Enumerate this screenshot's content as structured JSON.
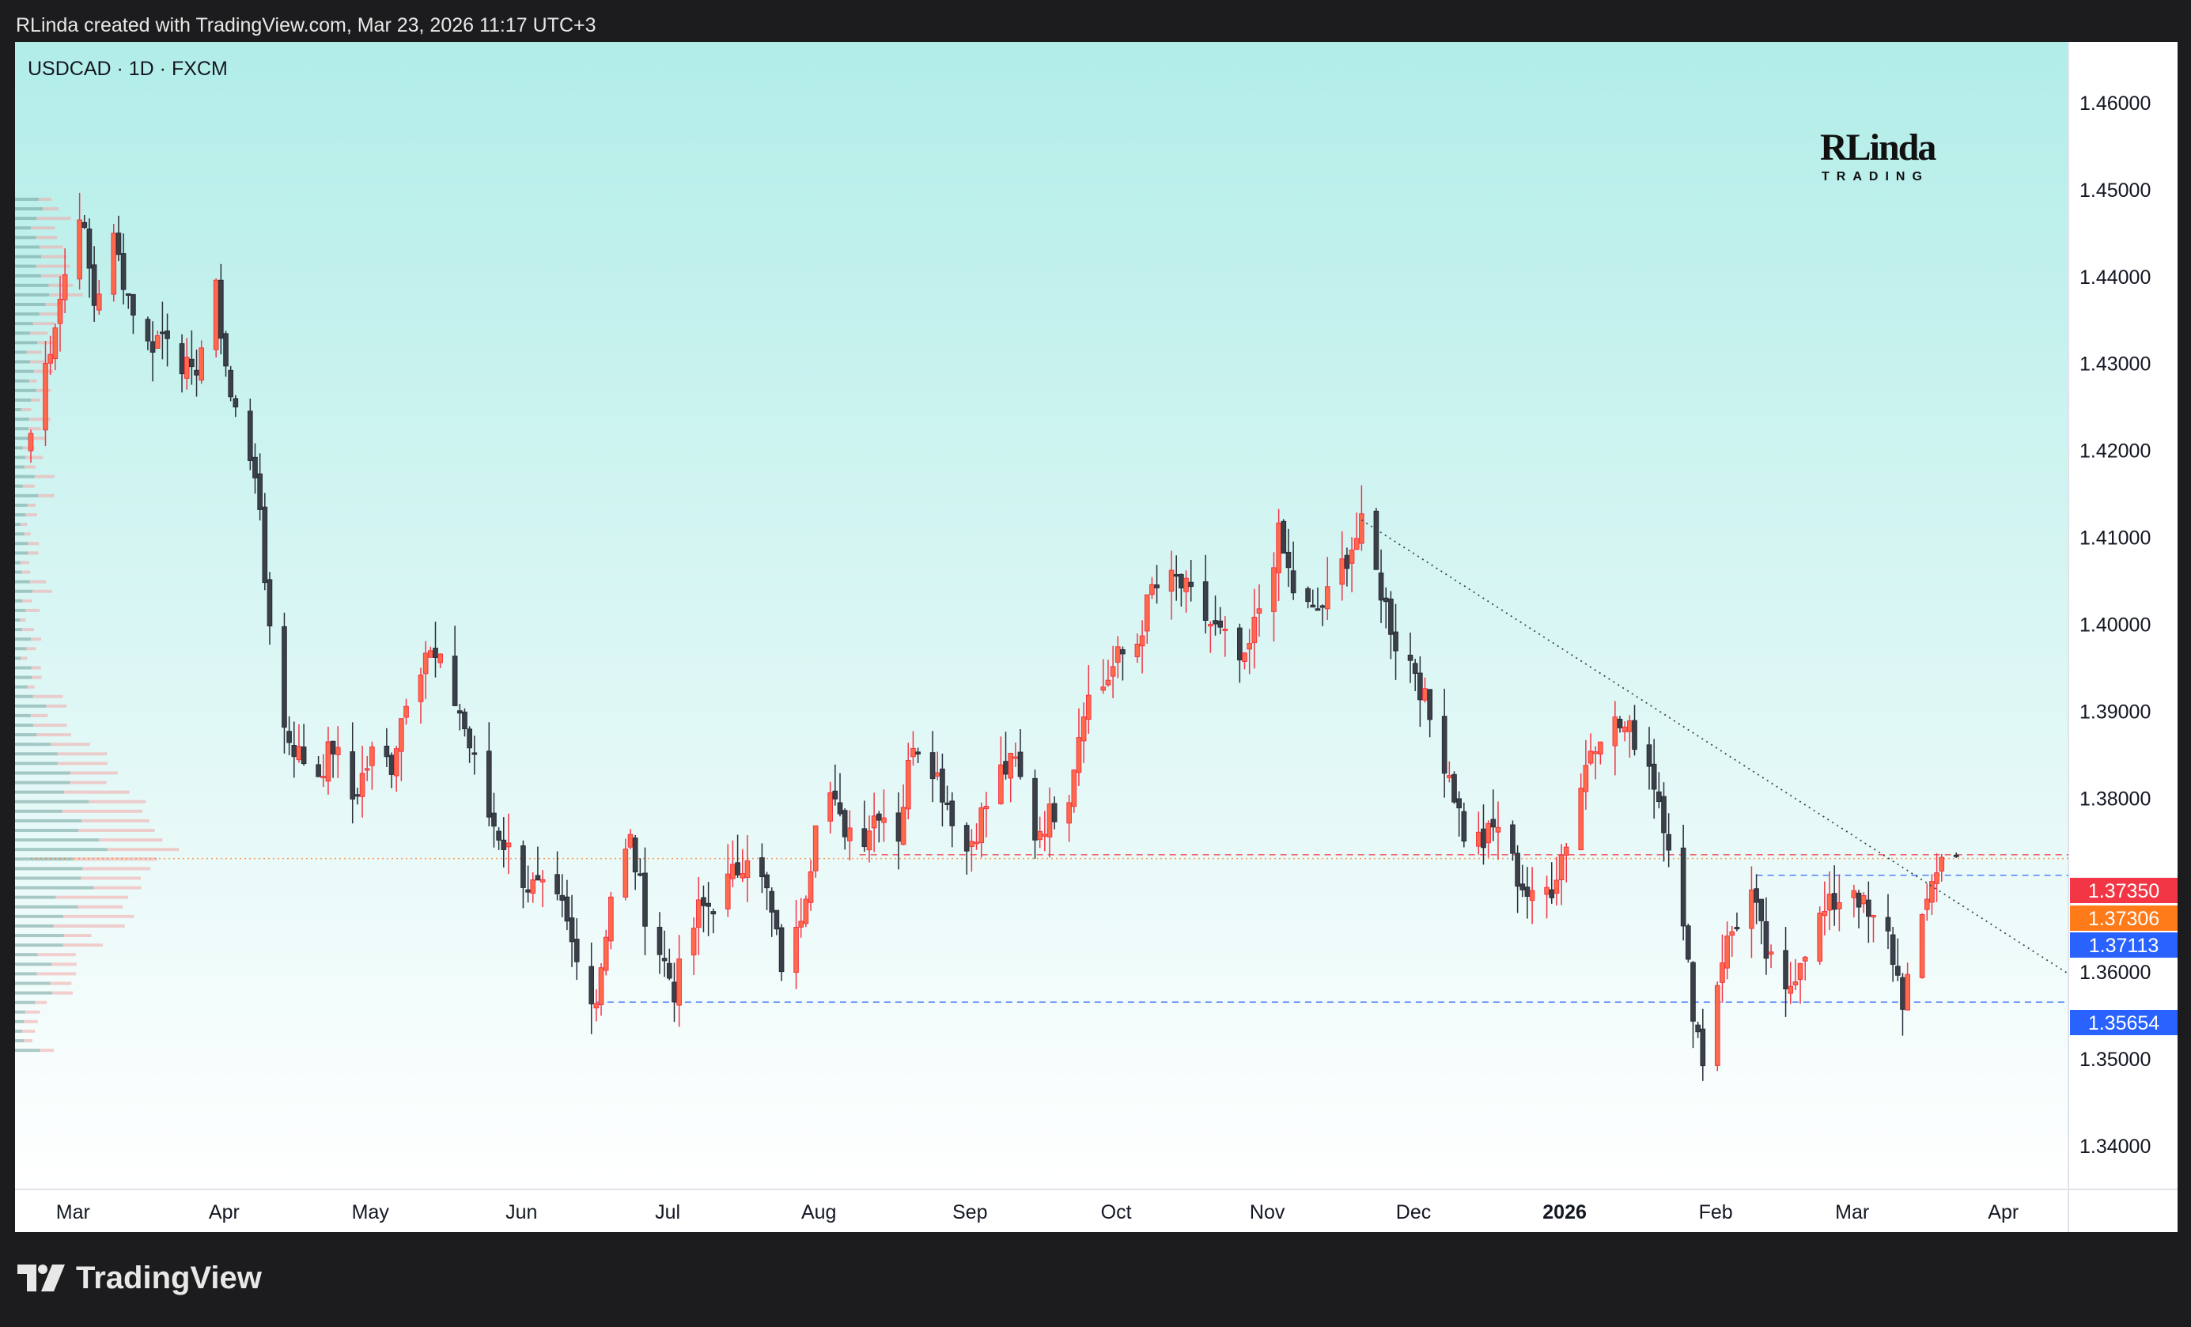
{
  "header": {
    "caption": "RLinda created with TradingView.com, Mar 23, 2026 11:17 UTC+3"
  },
  "chart": {
    "symbol_line": "USDCAD · 1D · FXCM"
  },
  "brand": {
    "logo_big": "RLinda",
    "logo_small": "TRADING"
  },
  "footer": {
    "logo_text": "TradingView"
  },
  "colors": {
    "up": "#f23645",
    "up_fill": "#ff6a4a",
    "down": "#2a2e39",
    "down_fill": "#3b3f48",
    "bg_top": "#b2ede8",
    "bg_bottom": "#ffffff",
    "label_red": "#f23645",
    "label_orange": "#ff7a18",
    "label_blue": "#2962ff"
  },
  "chart_data": {
    "type": "candlestick",
    "y_axis": {
      "range": [
        1.335,
        1.467
      ],
      "ticks": [
        "1.46000",
        "1.45000",
        "1.44000",
        "1.43000",
        "1.42000",
        "1.41000",
        "1.40000",
        "1.39000",
        "1.38000",
        "1.37000",
        "1.36000",
        "1.35000",
        "1.34000"
      ]
    },
    "x_axis": {
      "ticks": [
        "Mar",
        "Apr",
        "May",
        "Jun",
        "Jul",
        "Aug",
        "Sep",
        "Oct",
        "Nov",
        "Dec",
        "2026",
        "Feb",
        "Mar",
        "Apr"
      ],
      "bold_tick": "2026",
      "date_range": [
        "2025-02-21",
        "2026-04-15"
      ]
    },
    "price_labels": [
      {
        "text": "1.37350",
        "value": 1.3735,
        "color": "red"
      },
      {
        "text": "1.37306",
        "value": 1.37306,
        "color": "orange"
      },
      {
        "text": "1.37113",
        "value": 1.37113,
        "color": "blue"
      },
      {
        "text": "1.35654",
        "value": 1.35654,
        "color": "blue"
      }
    ],
    "levels": [
      {
        "value": 1.3735,
        "style": "dashed",
        "color": "red",
        "from": "2025-08-10"
      },
      {
        "value": 1.37306,
        "style": "dotted",
        "color": "orange",
        "from": "2025-02-21"
      },
      {
        "value": 1.37113,
        "style": "dashed",
        "color": "blue",
        "from": "2026-02-10"
      },
      {
        "value": 1.35654,
        "style": "dashed",
        "color": "blue",
        "from": "2025-06-17"
      }
    ],
    "trendline": {
      "from": [
        "2025-11-21",
        1.412
      ],
      "to": [
        "2026-04-15",
        1.3598
      ],
      "style": "dotted"
    },
    "anchors": [
      [
        "2025-02-21",
        1.422
      ],
      [
        "2025-02-26",
        1.435
      ],
      [
        "2025-03-03",
        1.448
      ],
      [
        "2025-03-06",
        1.437
      ],
      [
        "2025-03-10",
        1.444
      ],
      [
        "2025-03-13",
        1.438
      ],
      [
        "2025-03-17",
        1.432
      ],
      [
        "2025-03-21",
        1.434
      ],
      [
        "2025-03-26",
        1.428
      ],
      [
        "2025-03-31",
        1.438
      ],
      [
        "2025-04-03",
        1.426
      ],
      [
        "2025-04-08",
        1.418
      ],
      [
        "2025-04-10",
        1.405
      ],
      [
        "2025-04-14",
        1.388
      ],
      [
        "2025-04-17",
        1.385
      ],
      [
        "2025-04-21",
        1.383
      ],
      [
        "2025-04-24",
        1.386
      ],
      [
        "2025-04-28",
        1.38
      ],
      [
        "2025-05-02",
        1.385
      ],
      [
        "2025-05-06",
        1.384
      ],
      [
        "2025-05-09",
        1.392
      ],
      [
        "2025-05-13",
        1.397
      ],
      [
        "2025-05-16",
        1.395
      ],
      [
        "2025-05-20",
        1.39
      ],
      [
        "2025-05-23",
        1.384
      ],
      [
        "2025-05-26",
        1.378
      ],
      [
        "2025-05-30",
        1.374
      ],
      [
        "2025-06-03",
        1.37
      ],
      [
        "2025-06-06",
        1.369
      ],
      [
        "2025-06-10",
        1.367
      ],
      [
        "2025-06-13",
        1.361
      ],
      [
        "2025-06-17",
        1.357
      ],
      [
        "2025-06-20",
        1.369
      ],
      [
        "2025-06-24",
        1.375
      ],
      [
        "2025-06-27",
        1.367
      ],
      [
        "2025-07-01",
        1.361
      ],
      [
        "2025-07-03",
        1.358
      ],
      [
        "2025-07-08",
        1.367
      ],
      [
        "2025-07-11",
        1.368
      ],
      [
        "2025-07-15",
        1.371
      ],
      [
        "2025-07-18",
        1.374
      ],
      [
        "2025-07-22",
        1.369
      ],
      [
        "2025-07-25",
        1.361
      ],
      [
        "2025-07-28",
        1.364
      ],
      [
        "2025-07-31",
        1.373
      ],
      [
        "2025-08-02",
        1.384
      ],
      [
        "2025-08-06",
        1.377
      ],
      [
        "2025-08-11",
        1.376
      ],
      [
        "2025-08-14",
        1.379
      ],
      [
        "2025-08-18",
        1.376
      ],
      [
        "2025-08-21",
        1.387
      ],
      [
        "2025-08-25",
        1.384
      ],
      [
        "2025-08-27",
        1.381
      ],
      [
        "2025-09-01",
        1.374
      ],
      [
        "2025-09-04",
        1.378
      ],
      [
        "2025-09-08",
        1.383
      ],
      [
        "2025-09-11",
        1.384
      ],
      [
        "2025-09-15",
        1.376
      ],
      [
        "2025-09-18",
        1.378
      ],
      [
        "2025-09-22",
        1.381
      ],
      [
        "2025-09-25",
        1.391
      ],
      [
        "2025-09-29",
        1.393
      ],
      [
        "2025-10-02",
        1.396
      ],
      [
        "2025-10-06",
        1.398
      ],
      [
        "2025-10-09",
        1.404
      ],
      [
        "2025-10-14",
        1.405
      ],
      [
        "2025-10-17",
        1.403
      ],
      [
        "2025-10-21",
        1.4
      ],
      [
        "2025-10-24",
        1.398
      ],
      [
        "2025-10-28",
        1.395
      ],
      [
        "2025-10-31",
        1.402
      ],
      [
        "2025-11-04",
        1.41
      ],
      [
        "2025-11-07",
        1.404
      ],
      [
        "2025-11-11",
        1.401
      ],
      [
        "2025-11-14",
        1.403
      ],
      [
        "2025-11-18",
        1.408
      ],
      [
        "2025-11-21",
        1.411
      ],
      [
        "2025-11-25",
        1.404
      ],
      [
        "2025-11-28",
        1.398
      ],
      [
        "2025-12-02",
        1.395
      ],
      [
        "2025-12-05",
        1.389
      ],
      [
        "2025-12-09",
        1.383
      ],
      [
        "2025-12-12",
        1.376
      ],
      [
        "2025-12-16",
        1.375
      ],
      [
        "2025-12-19",
        1.377
      ],
      [
        "2025-12-23",
        1.371
      ],
      [
        "2025-12-26",
        1.368
      ],
      [
        "2025-12-30",
        1.37
      ],
      [
        "2026-01-03",
        1.377
      ],
      [
        "2026-01-07",
        1.386
      ],
      [
        "2026-01-10",
        1.389
      ],
      [
        "2026-01-14",
        1.388
      ],
      [
        "2026-01-18",
        1.386
      ],
      [
        "2026-01-21",
        1.38
      ],
      [
        "2026-01-24",
        1.373
      ],
      [
        "2026-01-28",
        1.356
      ],
      [
        "2026-01-30",
        1.35
      ],
      [
        "2026-02-03",
        1.362
      ],
      [
        "2026-02-06",
        1.366
      ],
      [
        "2026-02-09",
        1.369
      ],
      [
        "2026-02-12",
        1.362
      ],
      [
        "2026-02-16",
        1.357
      ],
      [
        "2026-02-19",
        1.362
      ],
      [
        "2026-02-23",
        1.366
      ],
      [
        "2026-02-26",
        1.368
      ],
      [
        "2026-03-02",
        1.37
      ],
      [
        "2026-03-05",
        1.366
      ],
      [
        "2026-03-09",
        1.364
      ],
      [
        "2026-03-12",
        1.357
      ],
      [
        "2026-03-16",
        1.365
      ],
      [
        "2026-03-18",
        1.371
      ],
      [
        "2026-03-20",
        1.373
      ],
      [
        "2026-03-23",
        1.3731
      ]
    ],
    "volume_profile": {
      "side": "left",
      "present": true
    }
  }
}
